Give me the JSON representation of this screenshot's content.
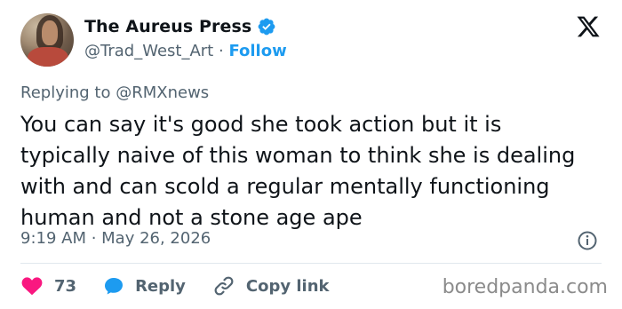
{
  "author": {
    "display_name": "The Aureus Press",
    "handle": "@Trad_West_Art",
    "separator": "·",
    "follow_label": "Follow"
  },
  "reply_context": {
    "prefix": "Replying to",
    "target": "@RMXnews"
  },
  "tweet": {
    "text": "You can say it's good she took action but it is typically naive of this woman to think she is dealing with and can scold a regular mentally functioning human and not a stone age ape",
    "timestamp": "9:19 AM · May 26, 2026"
  },
  "actions": {
    "like_count": "73",
    "reply_label": "Reply",
    "copy_link_label": "Copy link"
  },
  "watermark": "boredpanda.com",
  "colors": {
    "accent": "#1d9bf0",
    "like": "#f91880",
    "secondary_text": "#536471",
    "primary_text": "#0f1419"
  },
  "icons": {
    "platform": "x-logo-icon",
    "verified": "verified-badge-icon",
    "info": "info-icon",
    "like": "heart-icon",
    "reply": "reply-bubble-icon",
    "copy_link": "link-icon"
  }
}
